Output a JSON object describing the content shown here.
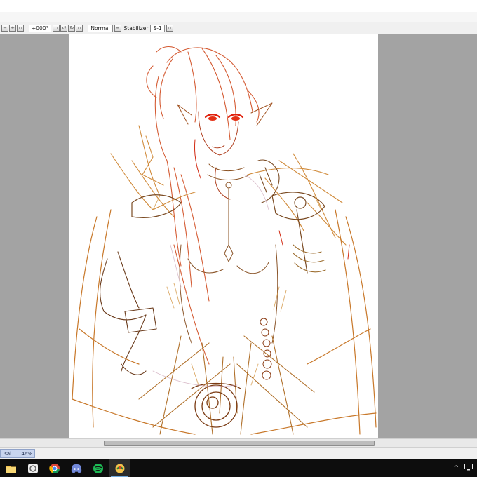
{
  "toolbar": {
    "rotation_value": "+000°",
    "blend_mode": "Normal",
    "stabilizer_label": "Stabilizer",
    "stabilizer_value": "S-1"
  },
  "file_tab": {
    "name": ".sai",
    "zoom": "46%"
  },
  "taskbar": {
    "apps": [
      "file-explorer",
      "sai-app",
      "chrome",
      "discord",
      "spotify",
      "paint-tool"
    ],
    "tray_chevron": "^"
  },
  "colors": {
    "workspace_bg": "#a3a3a3",
    "sketch_orange": "#c8782a",
    "sketch_red": "#d22a12",
    "sketch_brown": "#7a4a22",
    "sketch_pink": "#c9a0b4"
  }
}
